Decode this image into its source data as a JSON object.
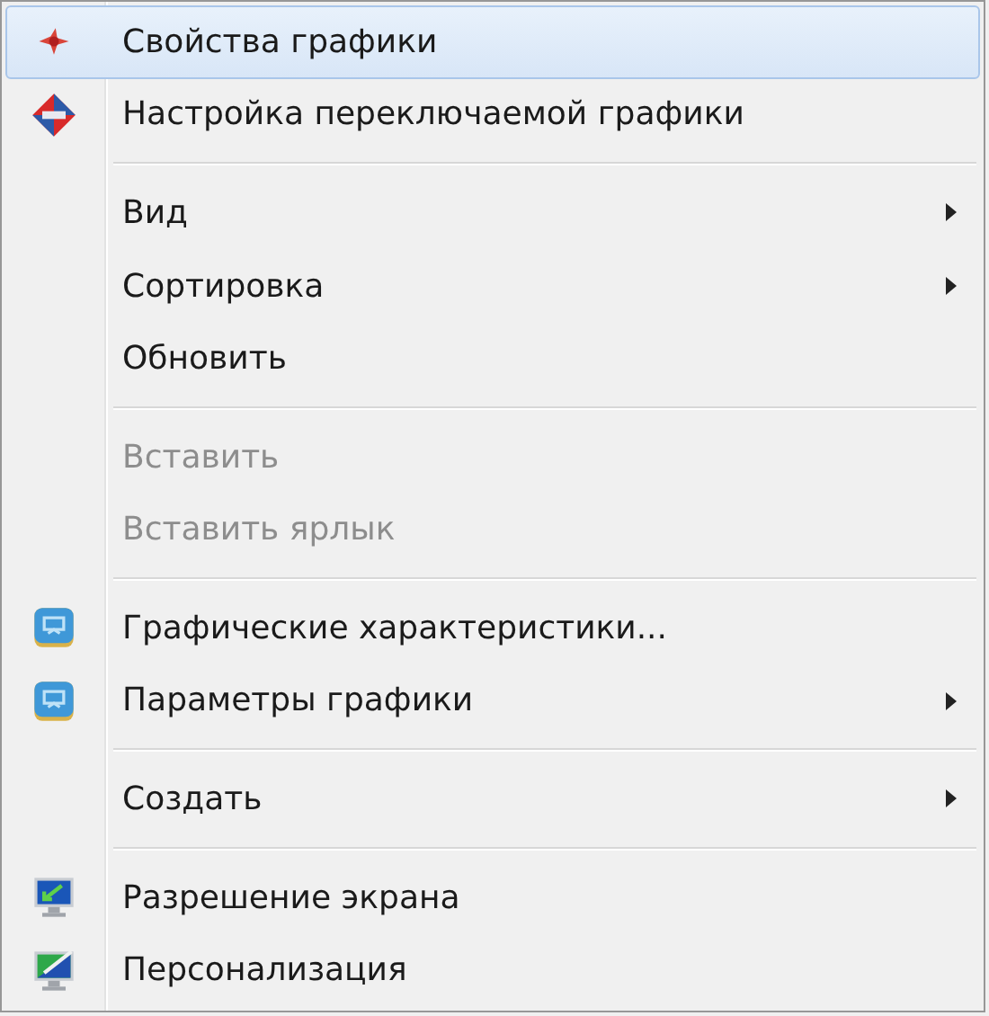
{
  "menu": {
    "entries": [
      {
        "kind": "item",
        "label": "Свойства графики",
        "submenu": false,
        "disabled": false,
        "selected": true
      },
      {
        "kind": "item",
        "label": "Настройка переключаемой графики",
        "submenu": false,
        "disabled": false,
        "selected": false
      },
      {
        "kind": "separator"
      },
      {
        "kind": "item",
        "label": "Вид",
        "submenu": true,
        "disabled": false,
        "selected": false
      },
      {
        "kind": "item",
        "label": "Сортировка",
        "submenu": true,
        "disabled": false,
        "selected": false
      },
      {
        "kind": "item",
        "label": "Обновить",
        "submenu": false,
        "disabled": false,
        "selected": false
      },
      {
        "kind": "separator"
      },
      {
        "kind": "item",
        "label": "Вставить",
        "submenu": false,
        "disabled": true,
        "selected": false
      },
      {
        "kind": "item",
        "label": "Вставить ярлык",
        "submenu": false,
        "disabled": true,
        "selected": false
      },
      {
        "kind": "separator"
      },
      {
        "kind": "item",
        "label": "Графические характеристики...",
        "submenu": false,
        "disabled": false,
        "selected": false
      },
      {
        "kind": "item",
        "label": "Параметры графики",
        "submenu": true,
        "disabled": false,
        "selected": false
      },
      {
        "kind": "separator"
      },
      {
        "kind": "item",
        "label": "Создать",
        "submenu": true,
        "disabled": false,
        "selected": false
      },
      {
        "kind": "separator"
      },
      {
        "kind": "item",
        "label": "Разрешение экрана",
        "submenu": false,
        "disabled": false,
        "selected": false
      },
      {
        "kind": "item",
        "label": "Персонализация",
        "submenu": false,
        "disabled": false,
        "selected": false
      }
    ]
  }
}
